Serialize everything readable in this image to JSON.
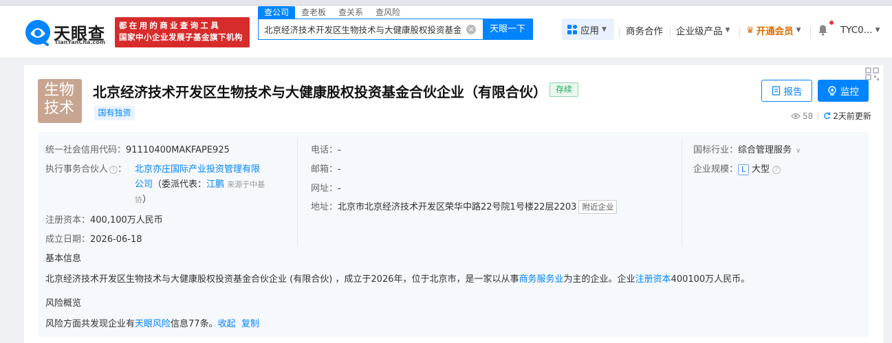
{
  "header": {
    "logo_cn": "天眼查",
    "logo_en": "TianYanCha.com",
    "promo_line1": "都在用的商业查询工具",
    "promo_line2": "国家中小企业发展子基金旗下机构",
    "tabs": [
      "查公司",
      "查老板",
      "查关系",
      "查风险"
    ],
    "search_value": "北京经济技术开发区生物技术与大健康股权投资基金合",
    "search_button": "天眼一下",
    "nav_app": "应用",
    "nav_business": "商务合作",
    "nav_enterprise": "企业级产品",
    "nav_vip": "开通会员",
    "nav_user": "TYC0..."
  },
  "company": {
    "avatar_line1": "生物",
    "avatar_line2": "技术",
    "name": "北京经济技术开发区生物技术与大健康股权投资基金合伙企业（有限合伙）",
    "status": "存续",
    "tag": "国有独资",
    "report_button": "报告",
    "monitor_button": "监控",
    "views": "58",
    "updated": "2天前更新"
  },
  "info": {
    "credit_code_label": "统一社会信用代码：",
    "credit_code": "91110400MAKFAPE925",
    "partner_label": "执行事务合伙人",
    "partner_colon": "：",
    "partner_name_1": "北京亦庄国际产业投资管理有限",
    "partner_name_2": "公司",
    "delegate_prefix": "（委派代表：",
    "delegate_name": "江鹏",
    "delegate_source_1": "来源于中基",
    "delegate_source_2": "协",
    "delegate_suffix": "）",
    "capital_label": "注册资本：",
    "capital": "400,100万人民币",
    "date_label": "成立日期：",
    "date": "2026-06-18",
    "phone_label": "电话：",
    "phone": "-",
    "email_label": "邮箱：",
    "email": "-",
    "website_label": "网址：",
    "website": "-",
    "address_label": "地址：",
    "address": "北京市北京经济技术开发区荣华中路22号院1号楼22层2203",
    "nearby": "附近企业",
    "industry_label": "国标行业：",
    "industry": "综合管理服务",
    "scale_label": "企业规模：",
    "scale_letter": "L",
    "scale": "大型"
  },
  "basic": {
    "title": "基本信息",
    "p1": "北京经济技术开发区生物技术与大健康股权投资基金合伙企业 (有限合伙) ，成立于2026年，位于北京市，是一家以从事",
    "link1": "商务服务业",
    "p2": "为主的企业。企业",
    "link2": "注册资本",
    "p3": "400100万人民币。"
  },
  "risk": {
    "title": "风险概览",
    "p1": "风险方面共发现企业有",
    "link": "天眼风险",
    "p2": "信息77条。",
    "collapse": "收起",
    "copy": "复制"
  },
  "colors": {
    "brand": "#0084ff",
    "promo": "#d82b2b",
    "vip": "#e06b00",
    "status": "#1aaa55"
  }
}
